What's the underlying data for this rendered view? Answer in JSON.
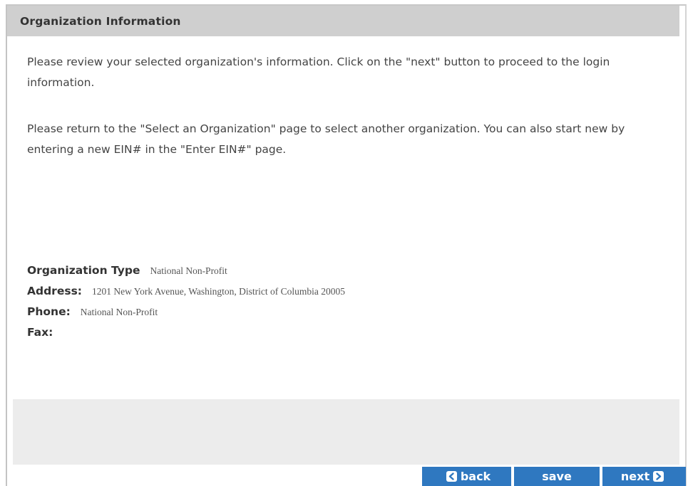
{
  "panel": {
    "title": "Organization Information"
  },
  "intro": {
    "paragraph1": "Please review your selected organization's information. Click on the \"next\" button to proceed to the login information.",
    "paragraph2": "Please return to the \"Select an Organization\" page to select another organization. You can also start new by entering a new EIN# in the \"Enter EIN#\" page."
  },
  "organization": {
    "type_label": "Organization Type",
    "type_value": "National Non-Profit",
    "address_label": "Address:",
    "address_value": "1201 New York Avenue, Washington, District of Columbia 20005",
    "phone_label": "Phone:",
    "phone_value": "National Non-Profit",
    "fax_label": "Fax:",
    "fax_value": ""
  },
  "footer": {
    "back_label": "back",
    "save_label": "save",
    "next_label": "next",
    "back_icon": "arrow-left-icon",
    "next_icon": "arrow-right-icon"
  },
  "colors": {
    "header_bg": "#cfcfcf",
    "button_bg": "#2f78c0",
    "footer_gray": "#ececec"
  }
}
